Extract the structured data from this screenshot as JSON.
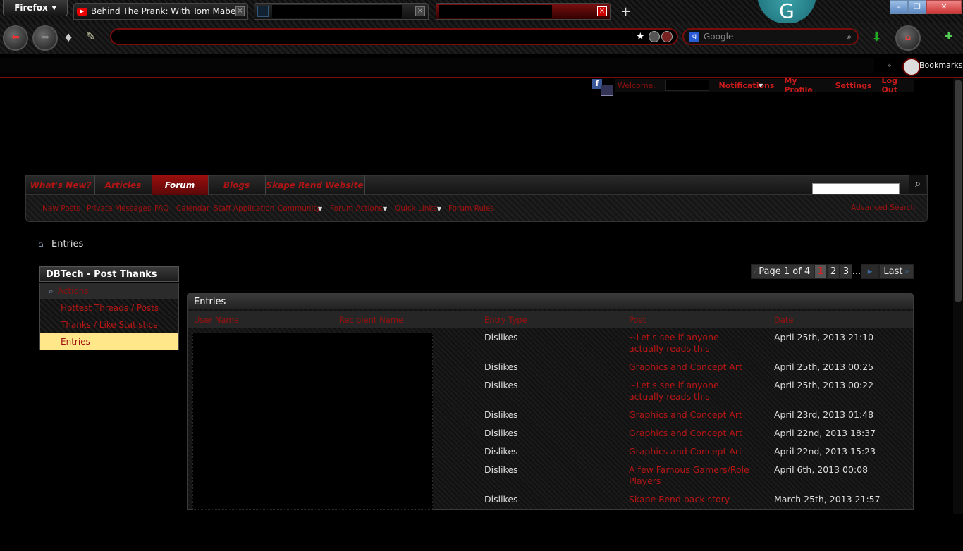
{
  "browser": {
    "menu_label": "Firefox",
    "tabs": [
      {
        "title": "Behind The Prank: With Tom Mabe ..."
      },
      {
        "title": ""
      },
      {
        "title": ""
      }
    ],
    "search_placeholder": "Google",
    "bookmarks_label": "Bookmarks",
    "profile_initial": "G"
  },
  "userbar": {
    "welcome": "Welcome,",
    "links": [
      "Notifications",
      "My Profile",
      "Settings",
      "Log Out"
    ]
  },
  "navbar": {
    "tabs": [
      "What's New?",
      "Articles",
      "Forum",
      "Blogs",
      "Skape Rend Website"
    ],
    "active_tab": "Forum",
    "sub_links": [
      "New Posts",
      "Private Messages",
      "FAQ",
      "Calendar",
      "Staff Application",
      "Community",
      "Forum Actions",
      "Quick Links",
      "Forum Rules"
    ],
    "advanced_search": "Advanced Search"
  },
  "breadcrumb": "Entries",
  "sidebar": {
    "title": "DBTech - Post Thanks",
    "section": "Actions",
    "items": [
      "Hottest Threads / Posts",
      "Thanks / Like Statistics",
      "Entries"
    ],
    "active_item": "Entries"
  },
  "pagination": {
    "label": "Page 1 of 4",
    "pages": [
      "1",
      "2",
      "3"
    ],
    "current": "1",
    "ellipsis": "...",
    "last": "Last"
  },
  "entries": {
    "title": "Entries",
    "columns": [
      "User Name",
      "Recipient Name",
      "Entry Type",
      "Post",
      "Date"
    ],
    "rows": [
      {
        "type": "Dislikes",
        "post": "~Let's see if anyone actually reads this",
        "date": "April 25th, 2013 21:10"
      },
      {
        "type": "Dislikes",
        "post": "Graphics and Concept Art",
        "date": "April 25th, 2013 00:25"
      },
      {
        "type": "Dislikes",
        "post": "~Let's see if anyone actually reads this",
        "date": "April 25th, 2013 00:22"
      },
      {
        "type": "Dislikes",
        "post": "Graphics and Concept Art",
        "date": "April 23rd, 2013 01:48"
      },
      {
        "type": "Dislikes",
        "post": "Graphics and Concept Art",
        "date": "April 22nd, 2013 18:37"
      },
      {
        "type": "Dislikes",
        "post": "Graphics and Concept Art",
        "date": "April 22nd, 2013 15:23"
      },
      {
        "type": "Dislikes",
        "post": "A few Famous Gamers/Role Players",
        "date": "April 6th, 2013 00:08"
      },
      {
        "type": "Dislikes",
        "post": "Skape Rend back story",
        "date": "March 25th, 2013 21:57"
      }
    ]
  }
}
